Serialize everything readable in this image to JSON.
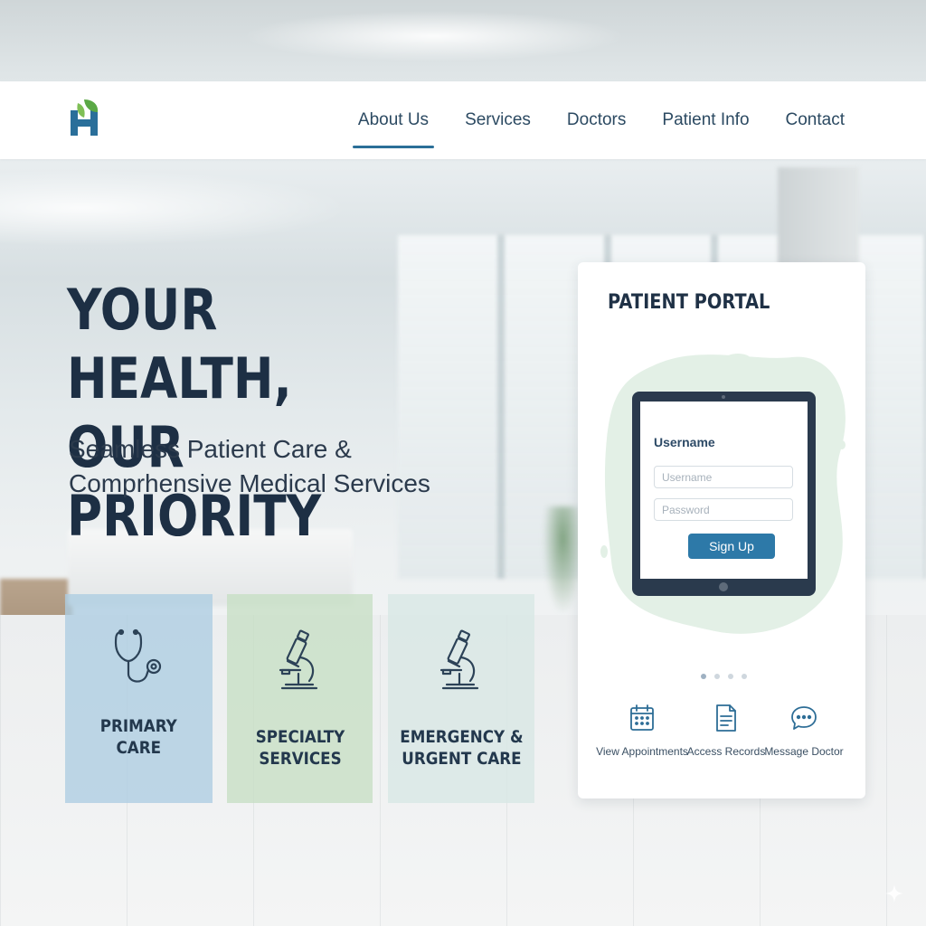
{
  "nav": {
    "items": [
      {
        "label": "About Us",
        "active": true
      },
      {
        "label": "Services",
        "active": false
      },
      {
        "label": "Doctors",
        "active": false
      },
      {
        "label": "Patient Info",
        "active": false
      },
      {
        "label": "Contact",
        "active": false
      }
    ]
  },
  "hero": {
    "title": "YOUR HEALTH,\nOUR PRIORITY",
    "subtitle": "Seamless Patient Care &\nComprhensive Medical Services"
  },
  "services": [
    {
      "label": "PRIMARY\nCARE",
      "icon": "stethoscope-icon"
    },
    {
      "label": "SPECIALTY\nSERVICES",
      "icon": "microscope-icon"
    },
    {
      "label": "EMERGENCY &\nURGENT CARE",
      "icon": "microscope-icon"
    }
  ],
  "portal": {
    "title": "PATIENT PORTAL",
    "username_label": "Username",
    "username_placeholder": "Username",
    "password_placeholder": "Password",
    "signup_label": "Sign Up",
    "quick_links": [
      {
        "label": "View Appointments",
        "icon": "calendar-icon"
      },
      {
        "label": "Access Records",
        "icon": "document-icon"
      },
      {
        "label": "Message Doctor",
        "icon": "chat-bubble-icon"
      }
    ]
  },
  "colors": {
    "accent": "#2b6f98",
    "heading": "#1d2f44",
    "card_blue": "#adcde2",
    "card_green": "#c6dfc4",
    "card_mint": "#d8e7e5",
    "blob": "#e3f0e6"
  }
}
